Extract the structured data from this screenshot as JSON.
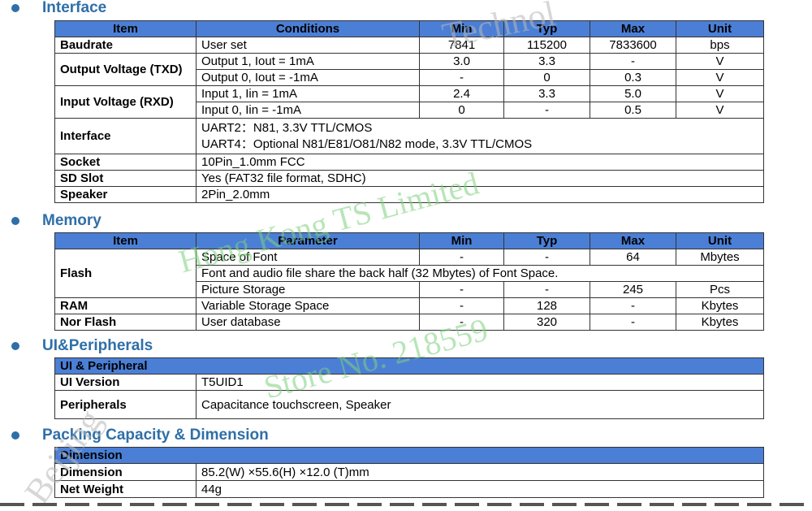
{
  "interface": {
    "title": "Interface",
    "headers": [
      "Item",
      "Conditions",
      "Min",
      "Typ",
      "Max",
      "Unit"
    ],
    "baudrate": {
      "item": "Baudrate",
      "cond": "User set",
      "min": "7841",
      "typ": "115200",
      "max": "7833600",
      "unit": "bps"
    },
    "output_voltage": {
      "item": "Output Voltage (TXD)",
      "row1": {
        "cond": "Output 1, Iout = 1mA",
        "min": "3.0",
        "typ": "3.3",
        "max": "-",
        "unit": "V"
      },
      "row2": {
        "cond": "Output 0, Iout = -1mA",
        "min": "-",
        "typ": "0",
        "max": "0.3",
        "unit": "V"
      }
    },
    "input_voltage": {
      "item": "Input Voltage (RXD)",
      "row1": {
        "cond": "Input 1, Iin = 1mA",
        "min": "2.4",
        "typ": "3.3",
        "max": "5.0",
        "unit": "V"
      },
      "row2": {
        "cond": "Input 0, Iin = -1mA",
        "min": "0",
        "typ": "-",
        "max": "0.5",
        "unit": "V"
      }
    },
    "iface": {
      "item": "Interface",
      "line1": "UART2：N81, 3.3V TTL/CMOS",
      "line2": "UART4：Optional N81/E81/O81/N82 mode, 3.3V TTL/CMOS"
    },
    "socket": {
      "item": "Socket",
      "value": "10Pin_1.0mm FCC"
    },
    "sd_slot": {
      "item": "SD Slot",
      "value": "Yes (FAT32 file format, SDHC)"
    },
    "speaker": {
      "item": "Speaker",
      "value": "2Pin_2.0mm"
    }
  },
  "memory": {
    "title": "Memory",
    "headers": [
      "Item",
      "Parameter",
      "Min",
      "Typ",
      "Max",
      "Unit"
    ],
    "flash": {
      "item": "Flash",
      "row1": {
        "param": "Space of Font",
        "min": "-",
        "typ": "-",
        "max": "64",
        "unit": "Mbytes"
      },
      "row2": {
        "param": "Font and audio file share the back half (32 Mbytes) of Font Space."
      },
      "row3": {
        "param": "Picture Storage",
        "min": "-",
        "typ": "-",
        "max": "245",
        "unit": "Pcs"
      }
    },
    "ram": {
      "item": "RAM",
      "param": "Variable Storage Space",
      "min": "-",
      "typ": "128",
      "max": "-",
      "unit": "Kbytes"
    },
    "nor_flash": {
      "item": "Nor Flash",
      "param": "User database",
      "min": "-",
      "typ": "320",
      "max": "-",
      "unit": "Kbytes"
    }
  },
  "ui_peripherals": {
    "title": "UI&Peripherals",
    "header": "UI & Peripheral",
    "ui_version": {
      "item": "UI Version",
      "value": "T5UID1"
    },
    "peripherals": {
      "item": "Peripherals",
      "value": "Capacitance touchscreen, Speaker"
    }
  },
  "packing": {
    "title": "Packing Capacity & Dimension",
    "header": "Dimension",
    "dimension": {
      "item": "Dimension",
      "value": "85.2(W) ×55.6(H) ×12.0 (T)mm"
    },
    "net_weight": {
      "item": "Net Weight",
      "value": "44g"
    }
  },
  "watermark": {
    "line1": "Hong Kong TS Limited",
    "line2": "Store No. 218559",
    "grey1": "Technol",
    "grey2": "Beijing"
  }
}
